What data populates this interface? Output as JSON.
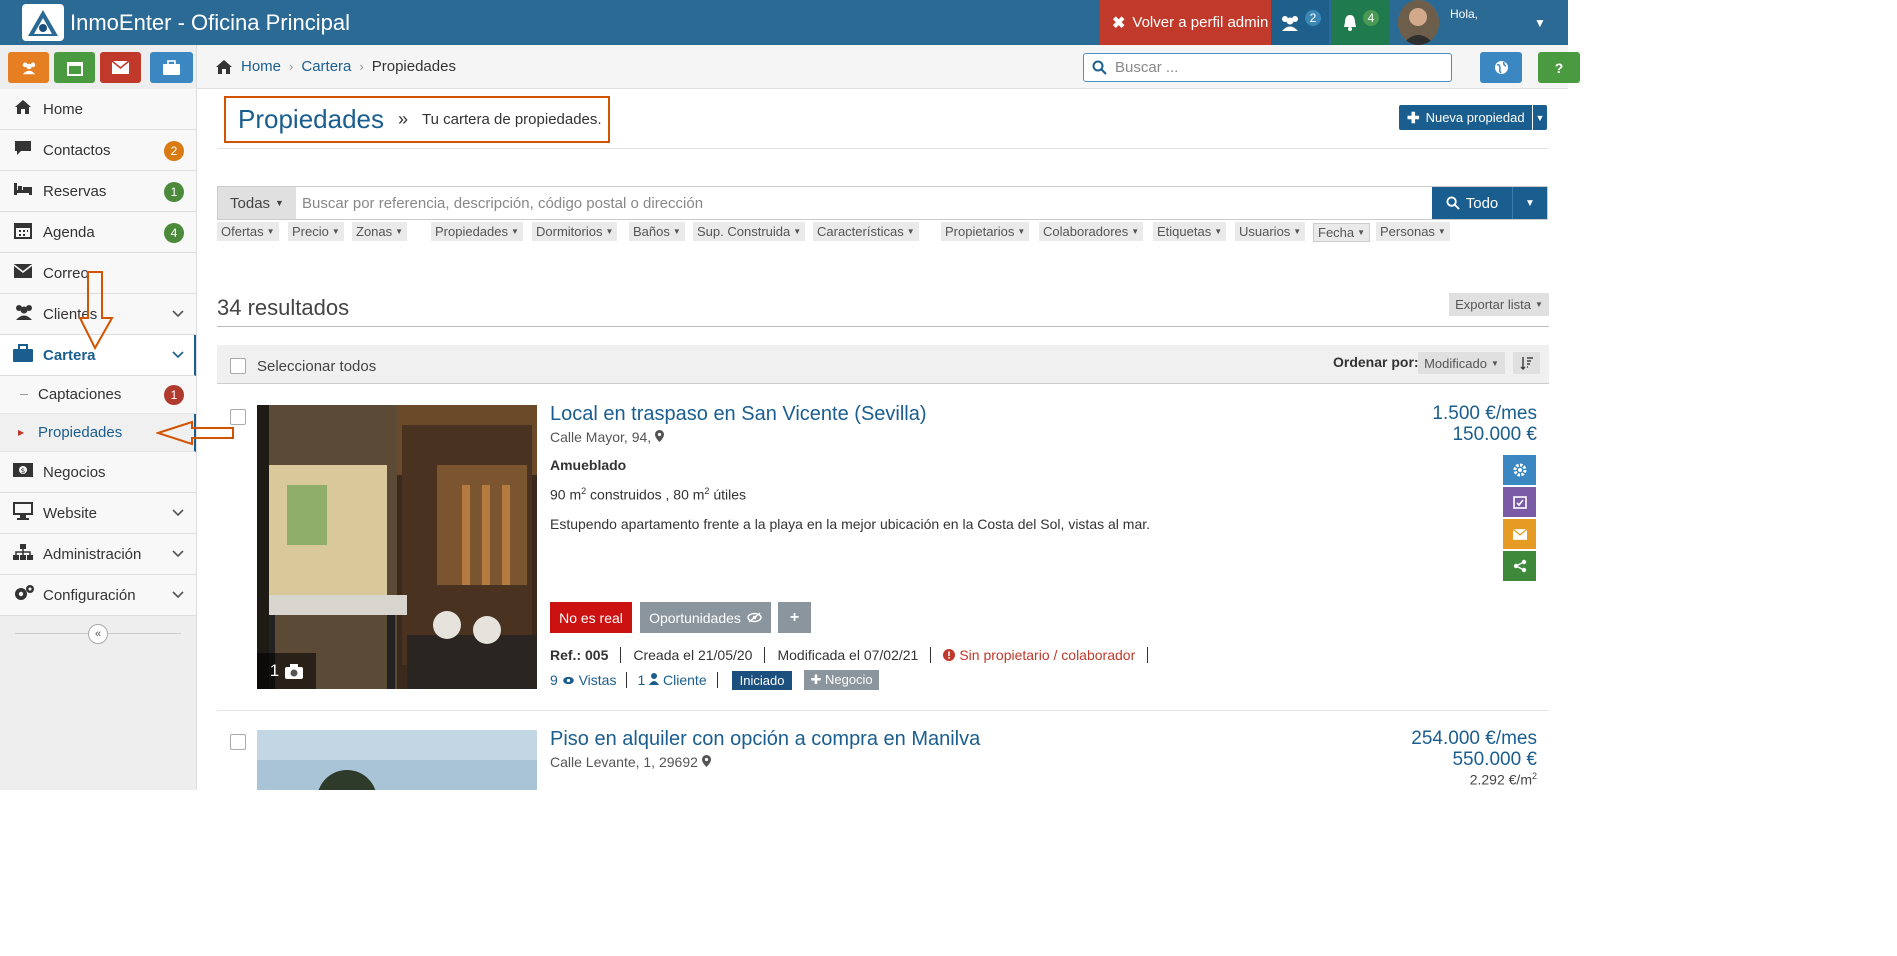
{
  "topbar": {
    "title": "InmoEnter - Oficina Principal",
    "admin_button": "Volver a perfil admin",
    "users_count": "2",
    "notifications_count": "4",
    "greeting": "Hola,"
  },
  "sidebar": {
    "quick_colors": [
      "#e67e22",
      "#4a9a3f",
      "#c0392b",
      "#3b87c2"
    ],
    "items": [
      {
        "label": "Home",
        "icon": "home-icon"
      },
      {
        "label": "Contactos",
        "icon": "comment-icon",
        "badge": "2",
        "badge_color": "#e67e22"
      },
      {
        "label": "Reservas",
        "icon": "bed-icon",
        "badge": "1",
        "badge_color": "#4a9a3f"
      },
      {
        "label": "Agenda",
        "icon": "calendar-icon",
        "badge": "4",
        "badge_color": "#4a9a3f"
      },
      {
        "label": "Correo",
        "icon": "envelope-icon"
      },
      {
        "label": "Clientes",
        "icon": "users-icon"
      },
      {
        "label": "Cartera",
        "icon": "briefcase-icon"
      },
      {
        "label": "Negocios",
        "icon": "money-icon"
      },
      {
        "label": "Website",
        "icon": "monitor-icon"
      },
      {
        "label": "Administración",
        "icon": "sitemap-icon"
      },
      {
        "label": "Configuración",
        "icon": "cogs-icon"
      }
    ],
    "subitems": [
      {
        "label": "Captaciones",
        "badge": "1"
      },
      {
        "label": "Propiedades"
      }
    ]
  },
  "breadcrumb": {
    "home": "Home",
    "cartera": "Cartera",
    "current": "Propiedades",
    "search_placeholder": "Buscar ..."
  },
  "header": {
    "title": "Propiedades",
    "separator": "»",
    "subtitle": "Tu cartera de propiedades.",
    "new_button": "Nueva propiedad"
  },
  "search": {
    "category": "Todas",
    "placeholder": "Buscar por referencia, descripción, código postal o dirección",
    "button": "Todo"
  },
  "filters": [
    "Ofertas",
    "Precio",
    "Zonas",
    "Propiedades",
    "Dormitorios",
    "Baños",
    "Sup. Construida",
    "Características",
    "Propietarios",
    "Colaboradores",
    "Etiquetas",
    "Usuarios",
    "Fecha",
    "Personas"
  ],
  "results": {
    "count": "34 resultados",
    "export": "Exportar lista",
    "select_all": "Seleccionar todos",
    "order_label": "Ordenar por:",
    "order_value": "Modificado"
  },
  "properties": [
    {
      "title": "Local en traspaso en San Vicente (Sevilla)",
      "address": "Calle Mayor, 94,",
      "furnished": "Amueblado",
      "area_built": "90 m",
      "area_sup1": "2",
      "area_mid": " construidos , 80 m",
      "area_sup2": "2",
      "area_end": " útiles",
      "description": "Estupendo apartamento frente a la playa en la mejor ubicación en la Costa del Sol, vistas al mar.",
      "price_rent": "1.500 €/mes",
      "price_sale": "150.000 €",
      "photos": "1",
      "tag_real": "No es real",
      "tag_opp": "Oportunidades",
      "ref_label": "Ref.:",
      "ref": "005",
      "created": "Creada el 21/05/20",
      "modified": "Modificada el 07/02/21",
      "warning": "Sin propietario / colaborador",
      "views": "9",
      "views_label": "Vistas",
      "clients": "1",
      "clients_label": "Cliente",
      "status": "Iniciado",
      "deal": "Negocio"
    },
    {
      "title": "Piso en alquiler con opción a compra en Manilva",
      "address": "Calle Levante, 1, 29692",
      "price_rent": "254.000 €/mes",
      "price_sale": "550.000 €",
      "price_m2": "2.292 €/m",
      "price_m2_sup": "2"
    }
  ]
}
